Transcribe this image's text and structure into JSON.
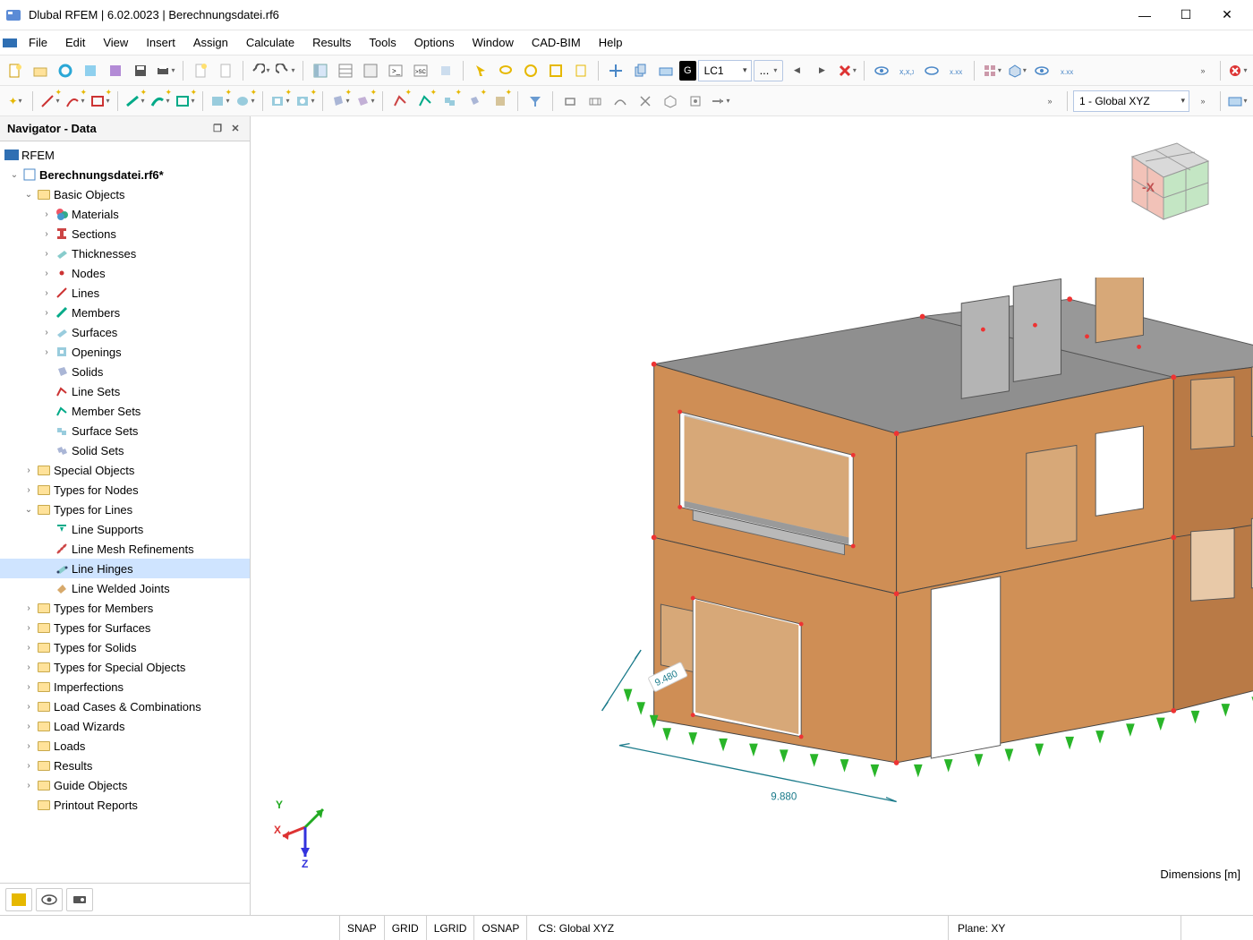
{
  "title": "Dlubal RFEM | 6.02.0023 | Berechnungsdatei.rf6",
  "menus": [
    "File",
    "Edit",
    "View",
    "Insert",
    "Assign",
    "Calculate",
    "Results",
    "Tools",
    "Options",
    "Window",
    "CAD-BIM",
    "Help"
  ],
  "toolbar1": {
    "lc_label_short": "G",
    "lc_label": "LC1",
    "lc_more": "..."
  },
  "toolbar2": {
    "csys": "1 - Global XYZ"
  },
  "navigator": {
    "title": "Navigator - Data",
    "root": "RFEM",
    "file": "Berechnungsdatei.rf6*",
    "basic_objects": "Basic Objects",
    "basic_children": [
      "Materials",
      "Sections",
      "Thicknesses",
      "Nodes",
      "Lines",
      "Members",
      "Surfaces",
      "Openings",
      "Solids",
      "Line Sets",
      "Member Sets",
      "Surface Sets",
      "Solid Sets"
    ],
    "special_objects": "Special Objects",
    "types_for_nodes": "Types for Nodes",
    "types_for_lines": "Types for Lines",
    "types_for_lines_children": [
      "Line Supports",
      "Line Mesh Refinements",
      "Line Hinges",
      "Line Welded Joints"
    ],
    "types_for_members": "Types for Members",
    "types_for_surfaces": "Types for Surfaces",
    "types_for_solids": "Types for Solids",
    "types_for_special": "Types for Special Objects",
    "imperfections": "Imperfections",
    "load_cases": "Load Cases & Combinations",
    "load_wizards": "Load Wizards",
    "loads": "Loads",
    "results": "Results",
    "guide_objects": "Guide Objects",
    "printout": "Printout Reports"
  },
  "canvas": {
    "dim1": "9.480",
    "dim2": "9.880",
    "dim_units": "Dimensions [m]",
    "axis_x": "X",
    "axis_y": "Y",
    "axis_z": "Z",
    "cube_face": "-X"
  },
  "status": {
    "snap": "SNAP",
    "grid": "GRID",
    "lgrid": "LGRID",
    "osnap": "OSNAP",
    "cs": "CS: Global XYZ",
    "plane": "Plane: XY"
  }
}
